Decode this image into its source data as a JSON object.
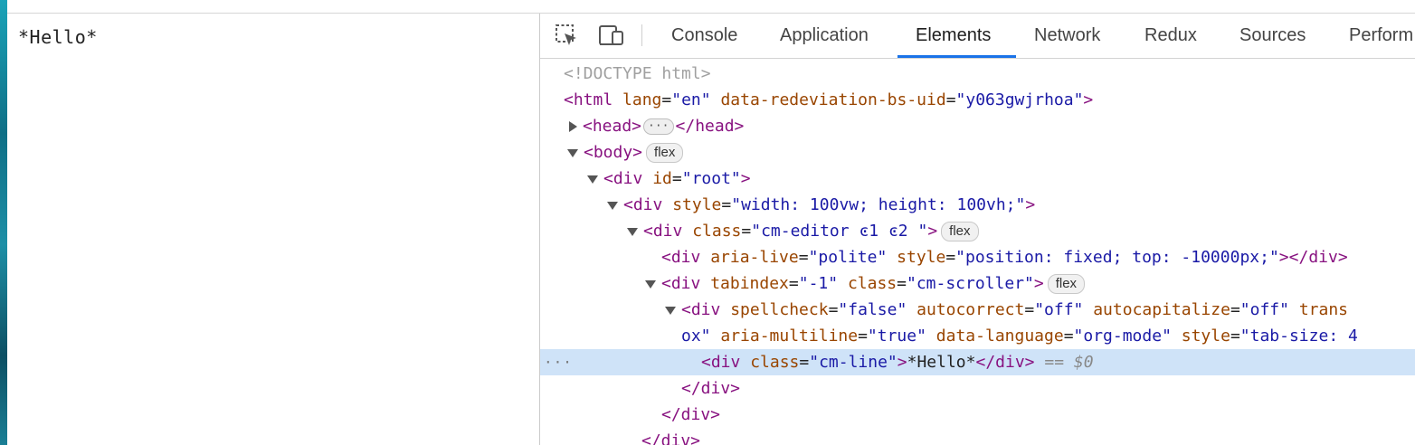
{
  "page": {
    "editor_text": "*Hello*"
  },
  "devtools": {
    "tabs": [
      "Console",
      "Application",
      "Elements",
      "Network",
      "Redux",
      "Sources",
      "Perform"
    ],
    "active_tab": "Elements",
    "icons": {
      "inspect": "inspect-element-icon",
      "device": "device-toolbar-icon"
    },
    "accent_color": "#1a73e8"
  },
  "dom": {
    "doctype": "<!DOCTYPE html>",
    "html_open": "<html",
    "html_lang_attr": "lang",
    "html_lang_val": "\"en\"",
    "html_uid_attr": "data-redeviation-bs-uid",
    "html_uid_val": "\"y063gwjrhoa\"",
    "gt": ">",
    "head_open": "<head>",
    "head_close": "</head>",
    "head_ellipsis": "···",
    "body_open": "<body>",
    "badge_flex": "flex",
    "div_open": "<div",
    "id_attr": "id",
    "id_val": "\"root\"",
    "style_attr": "style",
    "style_val_root": "\"width: 100vw; height: 100vh;\"",
    "class_attr": "class",
    "class_val_editor": "\"cm-editor ͼ1 ͼ2 \"",
    "aria_live_attr": "aria-live",
    "aria_live_val": "\"polite\"",
    "style_val_fixed": "\"position: fixed; top: -10000px;\"",
    "div_close": "</div>",
    "tabindex_attr": "tabindex",
    "tabindex_val": "\"-1\"",
    "class_val_scroller": "\"cm-scroller\"",
    "spellcheck_attr": "spellcheck",
    "spellcheck_val": "\"false\"",
    "autocorrect_attr": "autocorrect",
    "autocorrect_val": "\"off\"",
    "autocapitalize_attr": "autocapitalize",
    "autocapitalize_val": "\"off\"",
    "trans_attr": "trans",
    "wrap_val_tail": "ox\"",
    "aria_multiline_attr": "aria-multiline",
    "aria_multiline_val": "\"true\"",
    "data_language_attr": "data-language",
    "data_language_val": "\"org-mode\"",
    "tab_size_attr": "style",
    "tab_size_val": "\"tab-size: 4",
    "class_val_line": "\"cm-line\"",
    "line_text": "*Hello*",
    "selected_marker": "==",
    "selected_var": "$0",
    "gutter_ellipsis": "···"
  }
}
